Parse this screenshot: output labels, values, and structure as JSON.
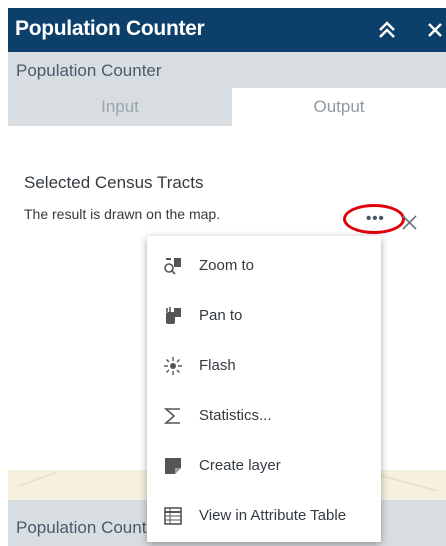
{
  "window": {
    "title": "Population Counter",
    "collapse_icon": "double-chevron-up-icon",
    "close_icon": "close-icon"
  },
  "subheader": {
    "label": "Population Counter"
  },
  "tabs": [
    {
      "label": "Input",
      "active": false
    },
    {
      "label": "Output",
      "active": true
    }
  ],
  "output": {
    "section_title": "Selected Census Tracts",
    "result_text": "The result is drawn on the map.",
    "more_button_label": "•••",
    "remove_icon": "close-icon"
  },
  "footer": {
    "label": "Population Counter"
  },
  "context_menu": {
    "items": [
      {
        "label": "Zoom to",
        "icon": "zoom-to-icon"
      },
      {
        "label": "Pan to",
        "icon": "pan-to-icon"
      },
      {
        "label": "Flash",
        "icon": "flash-icon"
      },
      {
        "label": "Statistics...",
        "icon": "sigma-icon"
      },
      {
        "label": "Create layer",
        "icon": "layer-icon"
      },
      {
        "label": "View in Attribute Table",
        "icon": "table-icon"
      }
    ]
  },
  "colors": {
    "titlebar": "#0d3f6b",
    "panel": "#d8dde2",
    "highlight_ring": "#e0000b"
  }
}
